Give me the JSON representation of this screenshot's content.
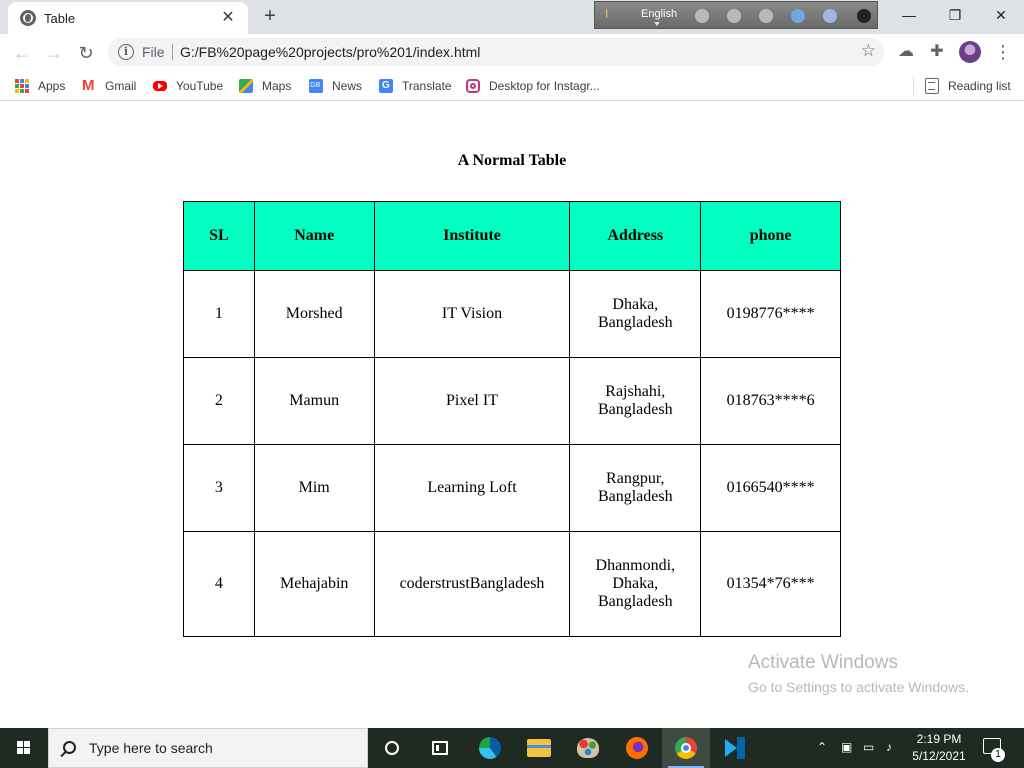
{
  "browser": {
    "tab_title": "Table",
    "tab_close": "✕",
    "new_tab": "+",
    "language_bar": {
      "label": "English"
    },
    "window_controls": {
      "minimize": "—",
      "restore": "❐",
      "close": "✕"
    },
    "omnibox": {
      "info_glyph": "i",
      "scheme_label": "File",
      "url": "G:/FB%20page%20projects/pro%201/index.html"
    },
    "bookmarks": [
      {
        "label": "Apps",
        "icon": "apps-grid-icon"
      },
      {
        "label": "Gmail",
        "icon": "gmail-icon"
      },
      {
        "label": "YouTube",
        "icon": "youtube-icon"
      },
      {
        "label": "Maps",
        "icon": "maps-icon"
      },
      {
        "label": "News",
        "icon": "news-icon"
      },
      {
        "label": "Translate",
        "icon": "translate-icon"
      },
      {
        "label": "Desktop for Instagr...",
        "icon": "instagram-icon"
      }
    ],
    "reading_list": "Reading list"
  },
  "page": {
    "heading": "A Normal Table",
    "table": {
      "headers": [
        "SL",
        "Name",
        "Institute",
        "Address",
        "phone"
      ],
      "rows": [
        {
          "sl": "1",
          "name": "Morshed",
          "institute": "IT Vision",
          "address": [
            "Dhaka,",
            "Bangladesh"
          ],
          "phone": "0198776****"
        },
        {
          "sl": "2",
          "name": "Mamun",
          "institute": "Pixel IT",
          "address": [
            "Rajshahi,",
            "Bangladesh"
          ],
          "phone": "018763****6"
        },
        {
          "sl": "3",
          "name": "Mim",
          "institute": "Learning Loft",
          "address": [
            "Rangpur,",
            "Bangladesh"
          ],
          "phone": "0166540****"
        },
        {
          "sl": "4",
          "name": "Mehajabin",
          "institute": "coderstrustBangladesh",
          "address": [
            "Dhanmondi,",
            "Dhaka,",
            "Bangladesh"
          ],
          "phone": "01354*76***"
        }
      ]
    }
  },
  "watermark": {
    "line1": "Activate Windows",
    "line2": "Go to Settings to activate Windows."
  },
  "taskbar": {
    "search_placeholder": "Type here to search",
    "time": "2:19 PM",
    "date": "5/12/2021",
    "notification_count": "1"
  },
  "colors": {
    "table_header_bg": "#00ffc0",
    "taskbar_bg": "#1f2a22",
    "tab_strip_bg": "#dee1e6"
  }
}
